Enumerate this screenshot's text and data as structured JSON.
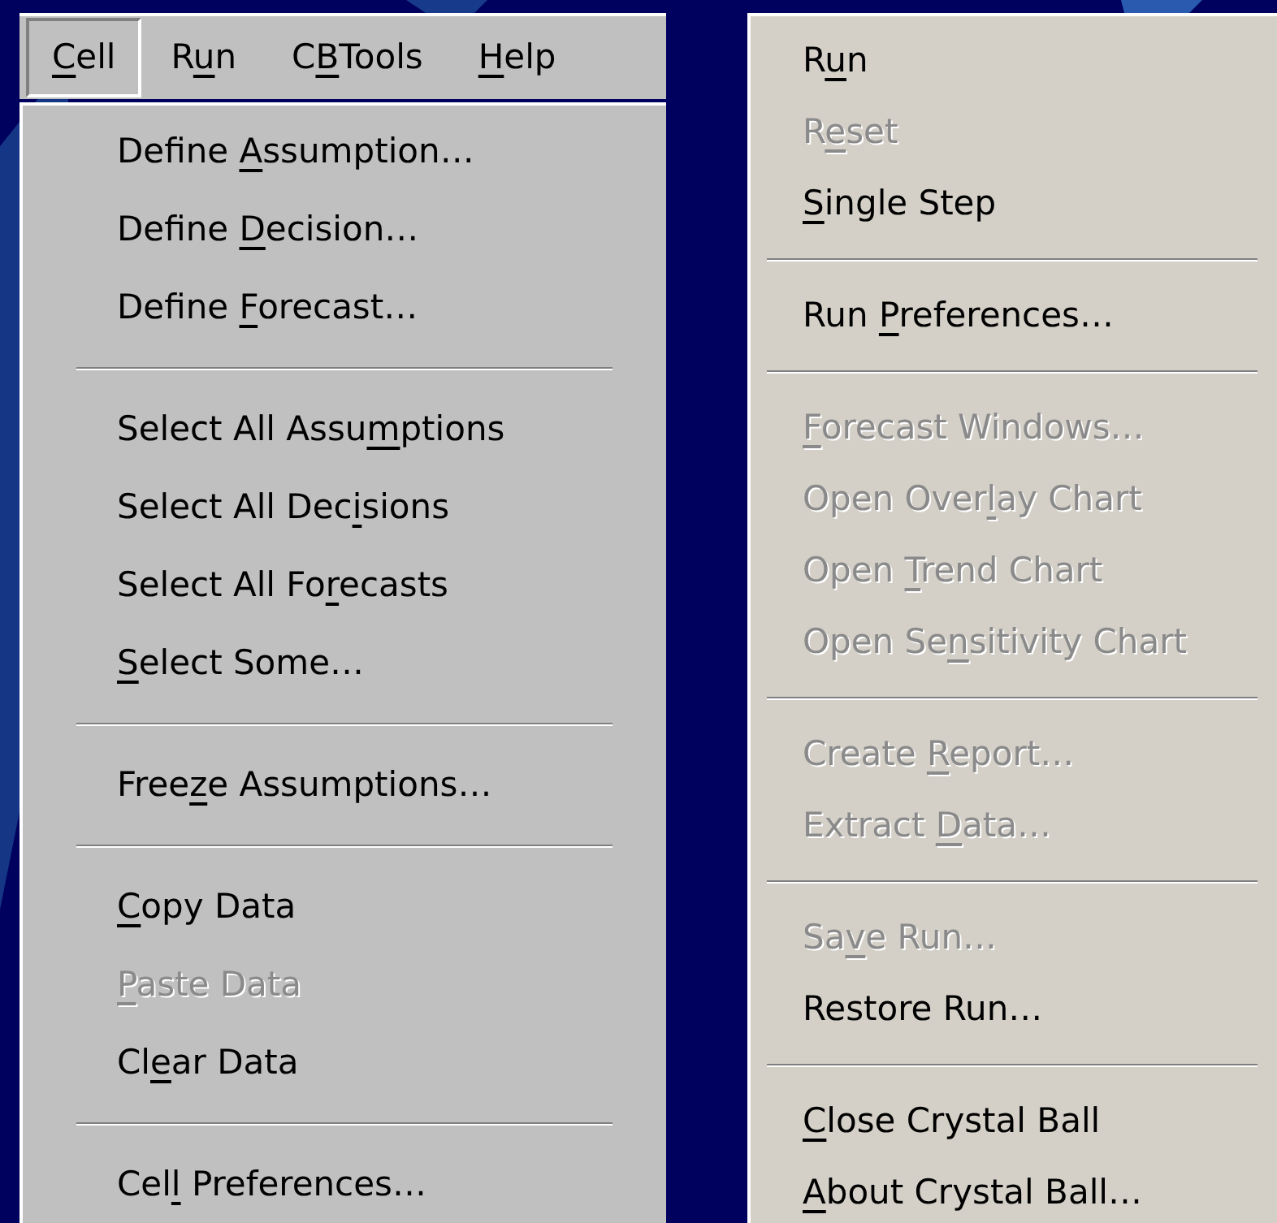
{
  "menu_bar": [
    {
      "hotkey": "C",
      "after": "ell",
      "selected": true
    },
    {
      "before": "R",
      "hotkey": "u",
      "after": "n",
      "selected": false
    },
    {
      "before": "C",
      "hotkey": "B",
      "after": "Tools",
      "selected": false
    },
    {
      "hotkey": "H",
      "after": "elp",
      "selected": false
    }
  ],
  "cell_menu": {
    "groups": [
      [
        {
          "before": "Define ",
          "hotkey": "A",
          "after": "ssumption…",
          "disabled": false
        },
        {
          "before": "Define ",
          "hotkey": "D",
          "after": "ecision…",
          "disabled": false
        },
        {
          "before": "Define ",
          "hotkey": "F",
          "after": "orecast…",
          "disabled": false
        }
      ],
      [
        {
          "before": "Select All Assu",
          "hotkey": "m",
          "after": "ptions",
          "disabled": false
        },
        {
          "before": "Select All Dec",
          "hotkey": "i",
          "after": "sions",
          "disabled": false
        },
        {
          "before": "Select All Fo",
          "hotkey": "r",
          "after": "ecasts",
          "disabled": false
        },
        {
          "hotkey": "S",
          "after": "elect Some…",
          "disabled": false
        }
      ],
      [
        {
          "before": "Free",
          "hotkey": "z",
          "after": "e Assumptions…",
          "disabled": false
        }
      ],
      [
        {
          "hotkey": "C",
          "after": "opy Data",
          "disabled": false
        },
        {
          "hotkey": "P",
          "after": "aste Data",
          "disabled": true
        },
        {
          "before": "Cl",
          "hotkey": "e",
          "after": "ar Data",
          "disabled": false
        }
      ],
      [
        {
          "before": "Cel",
          "hotkey": "l",
          "after": " Preferences…",
          "disabled": false
        }
      ]
    ]
  },
  "run_menu": {
    "groups": [
      [
        {
          "before": "R",
          "hotkey": "u",
          "after": "n",
          "disabled": false
        },
        {
          "before": "R",
          "hotkey": "e",
          "after": "set",
          "disabled": true
        },
        {
          "hotkey": "S",
          "after": "ingle Step",
          "disabled": false
        }
      ],
      [
        {
          "before": "Run ",
          "hotkey": "P",
          "after": "references…",
          "disabled": false
        }
      ],
      [
        {
          "hotkey": "F",
          "after": "orecast Windows…",
          "disabled": true
        },
        {
          "before": "Open Over",
          "hotkey": "l",
          "after": "ay Chart",
          "disabled": true
        },
        {
          "before": "Open ",
          "hotkey": "T",
          "after": "rend Chart",
          "disabled": true
        },
        {
          "before": "Open Se",
          "hotkey": "n",
          "after": "sitivity Chart",
          "disabled": true
        }
      ],
      [
        {
          "before": "Create ",
          "hotkey": "R",
          "after": "eport…",
          "disabled": true
        },
        {
          "before": "Extract ",
          "hotkey": "D",
          "after": "ata…",
          "disabled": true
        }
      ],
      [
        {
          "before": "Sa",
          "hotkey": "v",
          "after": "e Run…",
          "disabled": true
        },
        {
          "before": "Restore Run…",
          "disabled": false
        }
      ],
      [
        {
          "hotkey": "C",
          "after": "lose Crystal Ball",
          "disabled": false
        },
        {
          "hotkey": "A",
          "after": "bout Crystal Ball…",
          "disabled": false
        }
      ]
    ]
  }
}
